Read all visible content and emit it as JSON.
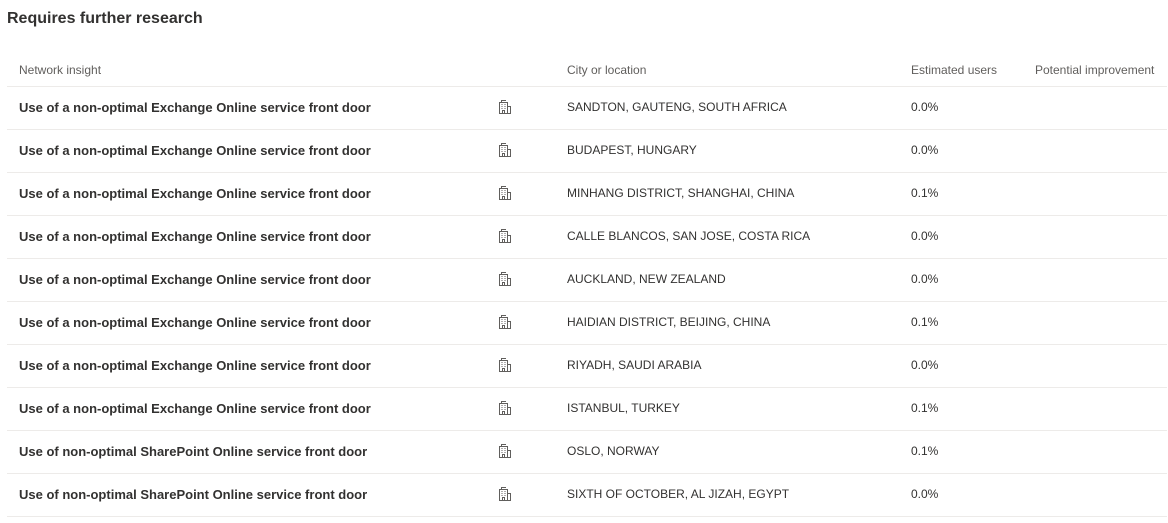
{
  "section": {
    "title": "Requires further research"
  },
  "table": {
    "headers": {
      "insight": "Network insight",
      "city": "City or location",
      "users": "Estimated users",
      "improvement": "Potential improvement"
    },
    "row_icon": "building-icon",
    "rows": [
      {
        "insight": "Use of a non-optimal Exchange Online service front door",
        "city": "SANDTON, GAUTENG, SOUTH AFRICA",
        "users": "0.0%",
        "improvement": ""
      },
      {
        "insight": "Use of a non-optimal Exchange Online service front door",
        "city": "BUDAPEST, HUNGARY",
        "users": "0.0%",
        "improvement": ""
      },
      {
        "insight": "Use of a non-optimal Exchange Online service front door",
        "city": "MINHANG DISTRICT, SHANGHAI, CHINA",
        "users": "0.1%",
        "improvement": ""
      },
      {
        "insight": "Use of a non-optimal Exchange Online service front door",
        "city": "CALLE BLANCOS, SAN JOSE, COSTA RICA",
        "users": "0.0%",
        "improvement": ""
      },
      {
        "insight": "Use of a non-optimal Exchange Online service front door",
        "city": "AUCKLAND, NEW ZEALAND",
        "users": "0.0%",
        "improvement": ""
      },
      {
        "insight": "Use of a non-optimal Exchange Online service front door",
        "city": "HAIDIAN DISTRICT, BEIJING, CHINA",
        "users": "0.1%",
        "improvement": ""
      },
      {
        "insight": "Use of a non-optimal Exchange Online service front door",
        "city": "RIYADH, SAUDI ARABIA",
        "users": "0.0%",
        "improvement": ""
      },
      {
        "insight": "Use of a non-optimal Exchange Online service front door",
        "city": "ISTANBUL, TURKEY",
        "users": "0.1%",
        "improvement": ""
      },
      {
        "insight": "Use of non-optimal SharePoint Online service front door",
        "city": "OSLO, NORWAY",
        "users": "0.1%",
        "improvement": ""
      },
      {
        "insight": "Use of non-optimal SharePoint Online service front door",
        "city": "SIXTH OF OCTOBER, AL JIZAH, EGYPT",
        "users": "0.0%",
        "improvement": ""
      }
    ]
  },
  "colors": {
    "text": "#323130",
    "header_text": "#605e5c",
    "divider": "#edebe9",
    "icon": "#605e5c"
  }
}
